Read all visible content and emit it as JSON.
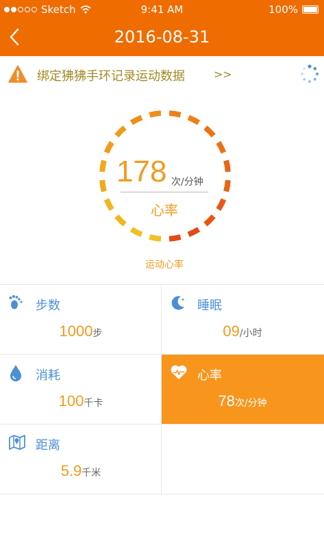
{
  "status_bar": {
    "carrier": "Sketch",
    "time": "9:41 AM",
    "battery": "100%"
  },
  "header": {
    "title": "2016-08-31",
    "bg_color": "#ef6c00"
  },
  "notice": {
    "text": "绑定狒狒手环记录运动数据",
    "arrow": ">>"
  },
  "heart_rate_ring": {
    "value": "178",
    "unit": "次/分钟",
    "label": "心率",
    "caption": "运动心率"
  },
  "stats": [
    {
      "icon": "footprints-icon",
      "name": "步数",
      "value": "1000",
      "unit": "步",
      "active": false
    },
    {
      "icon": "moon-icon",
      "name": "睡眠",
      "value": "09",
      "unit": "/小时",
      "active": false
    },
    {
      "icon": "drop-icon",
      "name": "消耗",
      "value": "100",
      "unit": "千卡",
      "active": false
    },
    {
      "icon": "heart-icon",
      "name": "心率",
      "value": "78",
      "unit": "次/分钟",
      "active": true
    },
    {
      "icon": "map-icon",
      "name": "距离",
      "value": "5.9",
      "unit": "千米",
      "active": false
    }
  ],
  "colors": {
    "accent": "#f39a1d",
    "label_blue": "#4d8fd6",
    "active_bg": "#f7951d"
  }
}
